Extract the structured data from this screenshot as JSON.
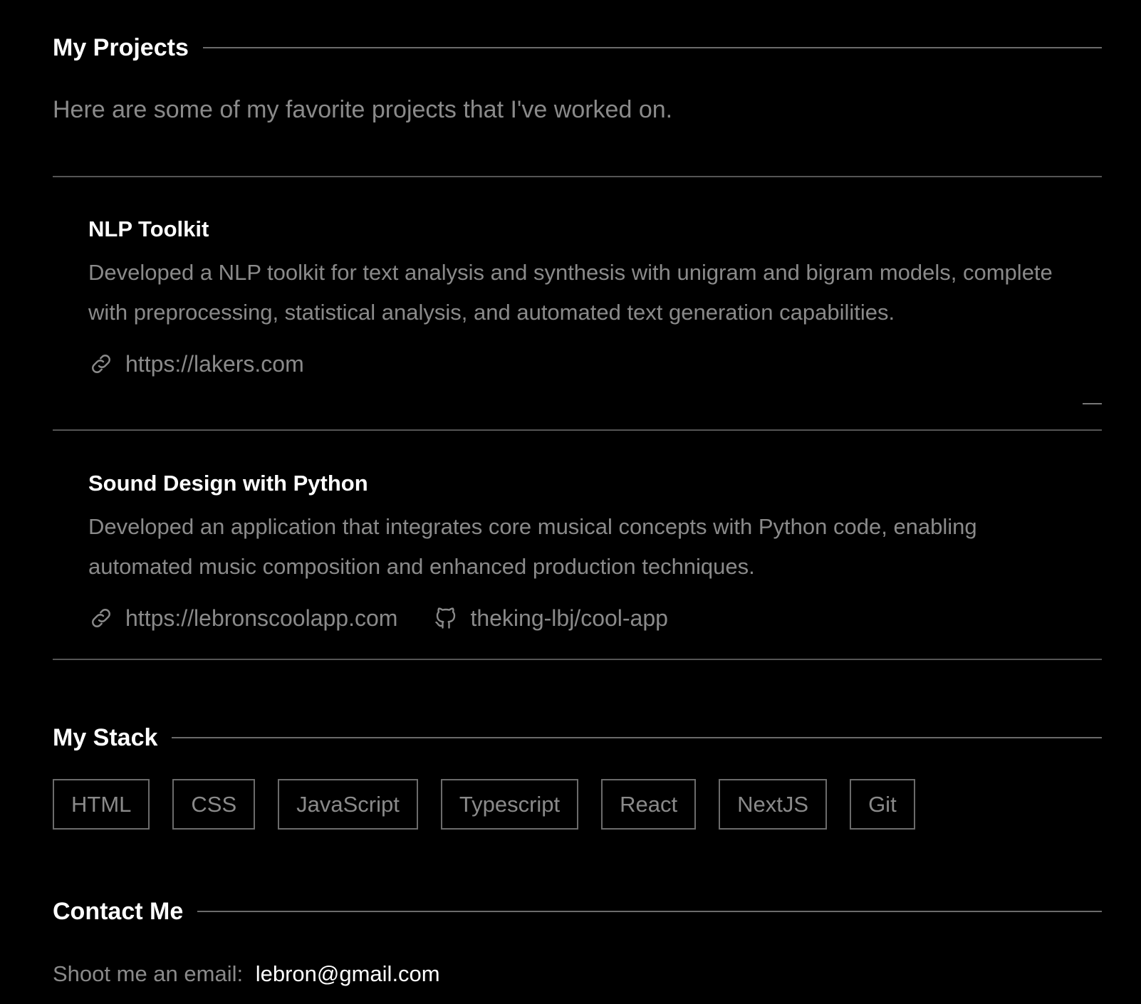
{
  "projects_section": {
    "title": "My Projects",
    "intro": "Here are some of my favorite projects that I've worked on."
  },
  "projects": [
    {
      "title": "NLP Toolkit",
      "description": "Developed a NLP toolkit for text analysis and synthesis with unigram and bigram models, complete with preprocessing, statistical analysis, and automated text generation capabilities.",
      "website": "https://lakers.com"
    },
    {
      "title": "Sound Design with Python",
      "description": "Developed an application that integrates core musical concepts with Python code, enabling automated music composition and enhanced production techniques.",
      "website": "https://lebronscoolapp.com",
      "repo": "theking-lbj/cool-app"
    }
  ],
  "stack_section": {
    "title": "My Stack",
    "items": [
      "HTML",
      "CSS",
      "JavaScript",
      "Typescript",
      "React",
      "NextJS",
      "Git"
    ]
  },
  "contact_section": {
    "title": "Contact Me",
    "label": "Shoot me an email:",
    "email": "lebron@gmail.com"
  },
  "icons": {
    "link": "link-icon",
    "github": "github-icon"
  },
  "colors": {
    "background": "#000000",
    "heading": "#ffffff",
    "muted_text": "#8a8a8a",
    "rule": "#6b6b6b"
  }
}
